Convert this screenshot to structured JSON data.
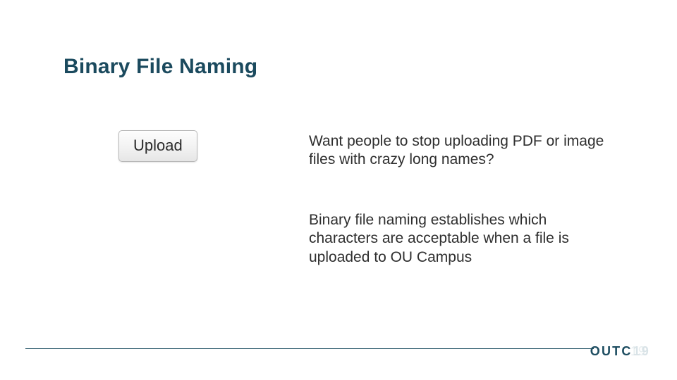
{
  "title": "Binary File Naming",
  "upload_button_label": "Upload",
  "paragraph1": "Want people to stop uploading PDF or image files with crazy long names?",
  "paragraph2": "Binary file naming establishes which characters are acceptable when a file is uploaded to OU Campus",
  "footer": {
    "brand_prefix": "OUTC",
    "brand_ghost": "19",
    "page_number_ghost": "19"
  }
}
